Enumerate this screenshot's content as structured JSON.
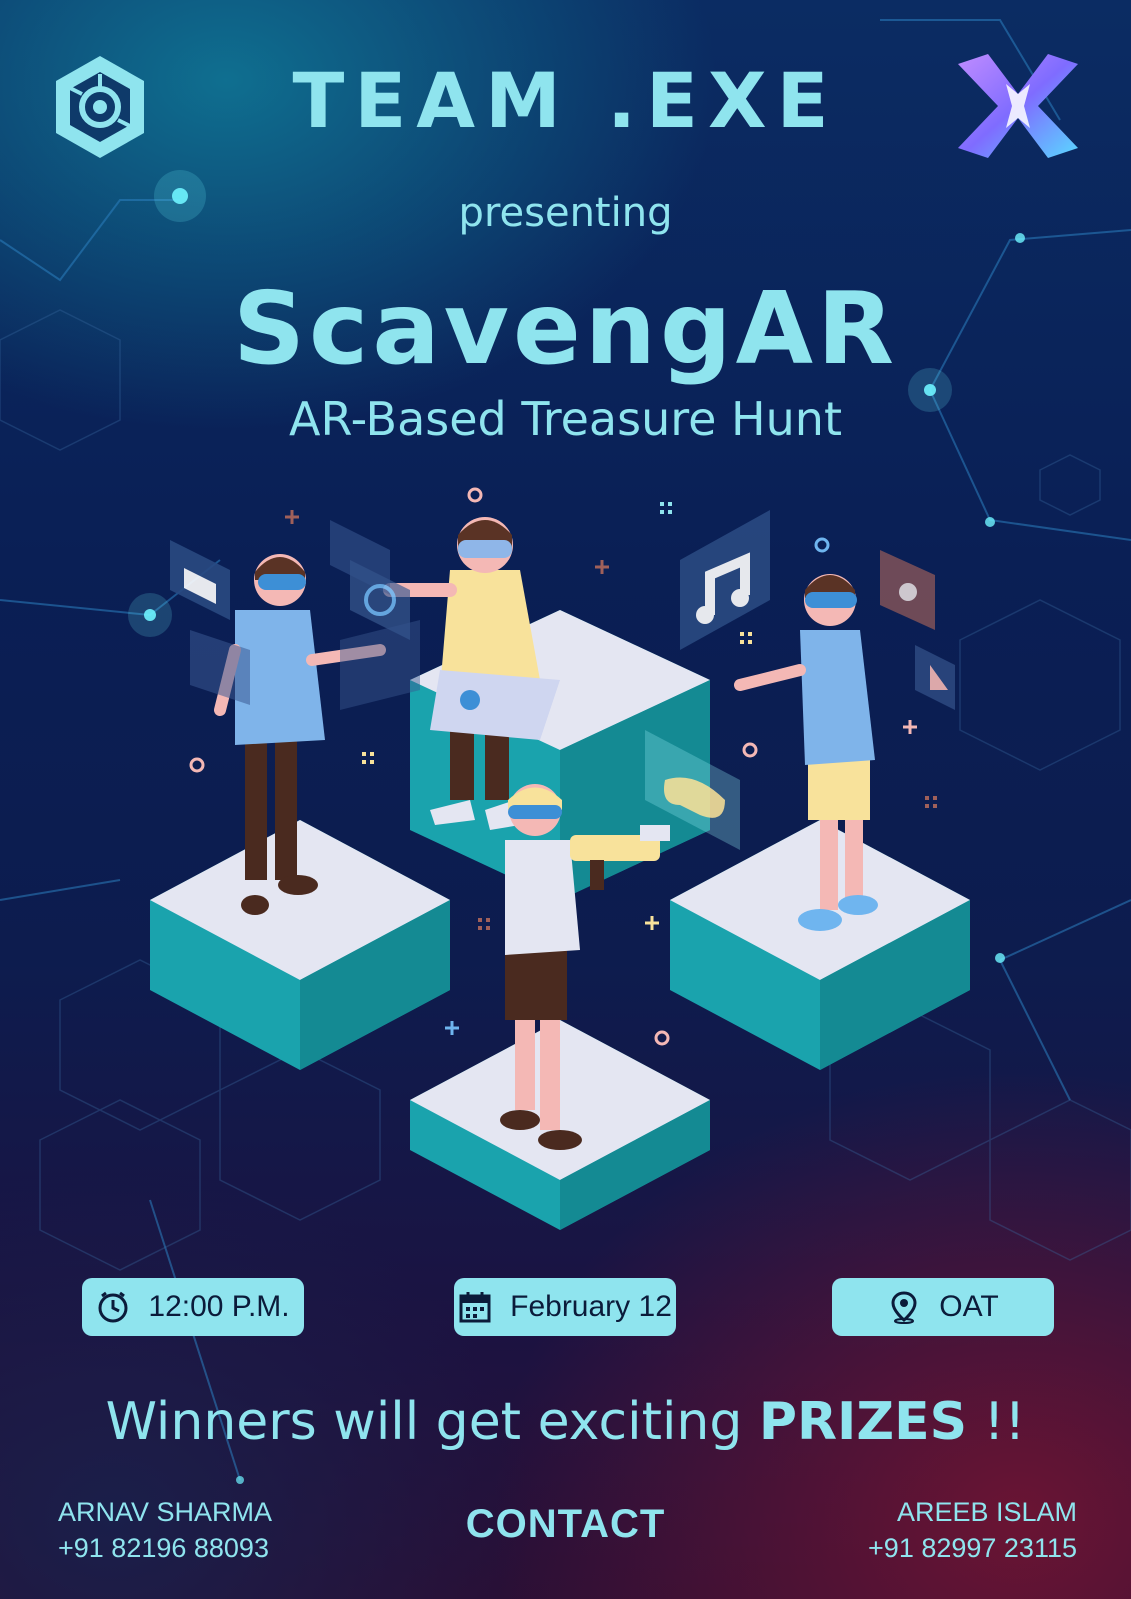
{
  "header": {
    "title": "TEAM .EXE",
    "left_logo_icon": "hexagon-circuit-logo-icon",
    "right_logo_icon": "x-cube-logo-icon"
  },
  "intro": {
    "presenting": "presenting",
    "event_name": "ScavengAR",
    "subtitle": "AR-Based Treasure Hunt"
  },
  "details": [
    {
      "icon": "clock-icon",
      "text": "12:00 P.M."
    },
    {
      "icon": "calendar-icon",
      "text": "February 12"
    },
    {
      "icon": "location-pin-icon",
      "text": "OAT"
    }
  ],
  "prizes": {
    "prefix": "Winners will get exciting ",
    "emphasis": "PRIZES",
    "suffix": " !!"
  },
  "contact": {
    "label": "CONTACT",
    "left": {
      "name": "ARNAV SHARMA",
      "phone": "+91 82196 88093"
    },
    "right": {
      "name": "AREEB ISLAM",
      "phone": "+91 82997 23115"
    }
  },
  "colors": {
    "accent": "#8fe4ee",
    "platform_top": "#e4e6f2",
    "platform_side": "#1aa3ad",
    "background_top": "#0b2c63",
    "background_bottom": "#2a0f35"
  }
}
